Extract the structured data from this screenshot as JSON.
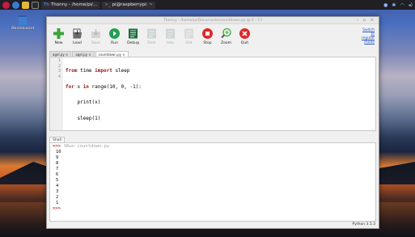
{
  "taskbar": {
    "apps": [
      {
        "label": "Thonny - /home/pi/..."
      },
      {
        "label": "pi@raspberrypi: ~"
      }
    ]
  },
  "desktop": {
    "trash_label": "Wastebasket"
  },
  "window": {
    "title": "Thonny - /home/pi/Documents/countdown.py @ 6 : 13",
    "switch_link": "Switch to regular mode"
  },
  "toolbar": [
    {
      "label": "New",
      "icon": "plus-icon",
      "enabled": true,
      "color": "#3aa33a"
    },
    {
      "label": "Load",
      "icon": "folder-icon",
      "enabled": true,
      "color": "#555555"
    },
    {
      "label": "Save",
      "icon": "save-icon",
      "enabled": false,
      "color": "#bdbdbd"
    },
    {
      "label": "Run",
      "icon": "play-icon",
      "enabled": true,
      "color": "#22a052"
    },
    {
      "label": "Debug",
      "icon": "debug-icon",
      "enabled": true,
      "color": "#1a6b3a"
    },
    {
      "label": "Over",
      "icon": "step-over-icon",
      "enabled": false,
      "color": "#bdbdbd"
    },
    {
      "label": "Into",
      "icon": "step-into-icon",
      "enabled": false,
      "color": "#bdbdbd"
    },
    {
      "label": "Out",
      "icon": "step-out-icon",
      "enabled": false,
      "color": "#bdbdbd"
    },
    {
      "label": "Stop",
      "icon": "stop-icon",
      "enabled": true,
      "color": "#e02828"
    },
    {
      "label": "Zoom",
      "icon": "zoom-icon",
      "enabled": true,
      "color": "#3aa33a"
    },
    {
      "label": "Quit",
      "icon": "quit-icon",
      "enabled": true,
      "color": "#e02828"
    }
  ],
  "tabs": [
    {
      "label": "agel.py ×",
      "active": false
    },
    {
      "label": "agel.py ×",
      "active": false
    },
    {
      "label": "countdown.py ×",
      "active": true
    }
  ],
  "editor": {
    "line_numbers": [
      "1",
      "2",
      "3",
      "4"
    ],
    "lines": [
      {
        "kw": "from",
        "rest": " time ",
        "kw2": "import",
        "rest2": " sleep"
      },
      {
        "kw": "for",
        "rest": " x ",
        "kw2": "in",
        "rest2": " range(10, 0, -1):"
      },
      {
        "kw": "",
        "rest": "    print(x)",
        "kw2": "",
        "rest2": ""
      },
      {
        "kw": "",
        "rest": "    sleep(1)",
        "kw2": "",
        "rest2": ""
      }
    ]
  },
  "shell": {
    "tab_label": "Shell",
    "prompt": ">>>",
    "run_command": "%Run countdown.py",
    "output": [
      "10",
      "9",
      "8",
      "7",
      "6",
      "5",
      "4",
      "3",
      "2",
      "1"
    ]
  },
  "status": {
    "interpreter": "Python 3.5.3"
  }
}
